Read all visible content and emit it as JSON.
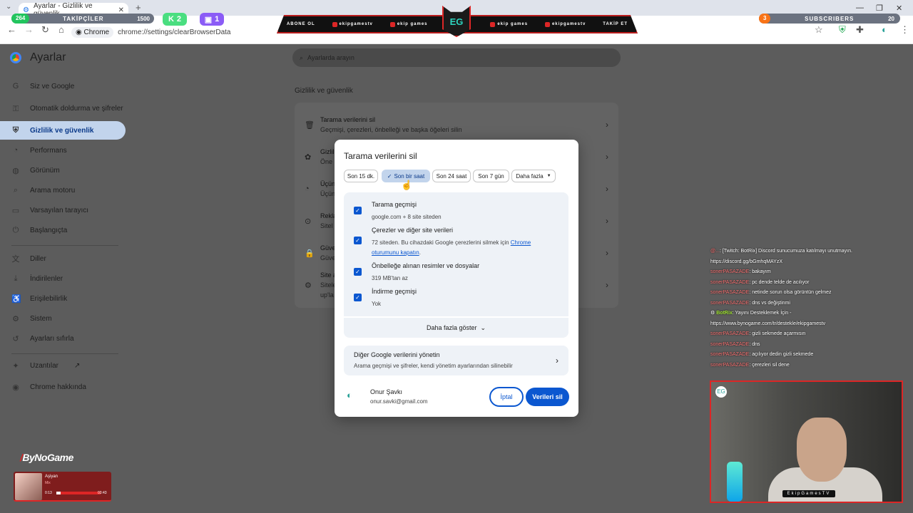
{
  "browser": {
    "tab_title": "Ayarlar - Gizlilik ve güvenlik",
    "tab_close": "✕",
    "new_tab": "+",
    "url_chip": "Chrome",
    "url": "chrome://settings/clearBrowserData"
  },
  "overlay": {
    "followers_count": "264",
    "followers_label": "TAKİPÇİLER",
    "followers_goal": "1500",
    "kick_count": "2",
    "twitch_count": "1",
    "banner_items": [
      "ABONE OL",
      "ekipgamestv",
      "ekip games",
      "ekip games",
      "ekipgamestv",
      "TAKİP ET"
    ],
    "logo_text": "EG",
    "subs_count": "3",
    "subs_label": "SUBSCRIBERS",
    "subs_goal": "20"
  },
  "settings": {
    "brand": "Ayarlar",
    "search_placeholder": "Ayarlarda arayın",
    "section_title": "Gizlilik ve güvenlik",
    "sidebar": [
      {
        "icon": "G",
        "label": "Siz ve Google"
      },
      {
        "icon": "⚿",
        "label": "Otomatik doldurma ve şifreler"
      },
      {
        "icon": "⛨",
        "label": "Gizlilik ve güvenlik"
      },
      {
        "icon": "◔",
        "label": "Performans"
      },
      {
        "icon": "◍",
        "label": "Görünüm"
      },
      {
        "icon": "⌕",
        "label": "Arama motoru"
      },
      {
        "icon": "▭",
        "label": "Varsayılan tarayıcı"
      },
      {
        "icon": "⏻",
        "label": "Başlangıçta"
      },
      {
        "icon": "文",
        "label": "Diller"
      },
      {
        "icon": "⤓",
        "label": "İndirilenler"
      },
      {
        "icon": "♿",
        "label": "Erişilebilirlik"
      },
      {
        "icon": "⚙",
        "label": "Sistem"
      },
      {
        "icon": "↺",
        "label": "Ayarları sıfırla"
      },
      {
        "icon": "✦",
        "label": "Uzantılar"
      },
      {
        "icon": "◉",
        "label": "Chrome hakkında"
      }
    ],
    "card_rows": [
      {
        "title": "Tarama verilerini sil",
        "desc": "Geçmişi, çerezleri, önbelleği ve başka öğeleri silin"
      },
      {
        "title": "Gizlil",
        "desc": "Öne"
      },
      {
        "title": "Üçün",
        "desc": "Üçün"
      },
      {
        "title": "Rekla",
        "desc": "Sitel"
      },
      {
        "title": "Güve",
        "desc": "Güve"
      },
      {
        "title": "Site a",
        "desc": "Sitele",
        "desc2": "up'la"
      }
    ]
  },
  "dialog": {
    "title": "Tarama verilerini sil",
    "time_ranges": [
      "Son 15 dk.",
      "Son bir saat",
      "Son 24 saat",
      "Son 7 gün",
      "Daha fazla"
    ],
    "selected_range": "Son bir saat",
    "options": [
      {
        "title": "Tarama geçmişi",
        "desc": "google.com + 8 site siteden",
        "checked": true
      },
      {
        "title": "Çerezler ve diğer site verileri",
        "desc": "72 siteden. Bu cihazdaki Google çerezlerini silmek için ",
        "link": "Chrome oturumunu kapatın",
        "desc_end": ".",
        "checked": true
      },
      {
        "title": "Önbelleğe alınan resimler ve dosyalar",
        "desc": "319 MB'tan az",
        "checked": true
      },
      {
        "title": "İndirme geçmişi",
        "desc": "Yok",
        "checked": true
      }
    ],
    "more_label": "Daha fazla göster",
    "google_title": "Diğer Google verilerini yönetin",
    "google_desc": "Arama geçmişi ve şifreler, kendi yönetim ayarlarından silinebilir",
    "account_name": "Onur Şavkı",
    "account_email": "onur.savki@gmail.com",
    "cancel_label": "İptal",
    "delete_label": "Verileri sil"
  },
  "chat": [
    {
      "user": "@...",
      "text": ": [Twitch: BotRix] Discord sunucumuza katılmayı unutmayın. https://discord.gg/bGmhqMAYzX"
    },
    {
      "user": "sonerPASAZADE",
      "text": ": bakayım"
    },
    {
      "user": "sonerPASAZADE",
      "text": ": pc dende telde de acılıyor"
    },
    {
      "user": "sonerPASAZADE",
      "text": ": netinde sorun olsa görüntün gelmez"
    },
    {
      "user": "sonerPASAZADE",
      "text": ": dns vs değiştinmi"
    },
    {
      "user": "BotRix",
      "text": ": Yayını Desteklemek İçin - https://www.bynogame.com/tr/destekle/ekipgamestv",
      "bot": true
    },
    {
      "user": "sonerPASAZADE",
      "text": ": gizli sekmede açarmısın"
    },
    {
      "user": "sonerPASAZADE",
      "text": ": dns"
    },
    {
      "user": "sonerPASAZADE",
      "text": ": açılıyor dedin gizli sekmede"
    },
    {
      "user": "sonerPASAZADE",
      "text": ": çerezleri sil dene"
    }
  ],
  "cam_tag": "EkipGamesTV",
  "bynogame": {
    "prefix": "/",
    "name": "ByNoGame"
  },
  "music": {
    "song": "Aşiyan",
    "artist": "Mix",
    "elapsed": "0:13",
    "total": "03:43",
    "progress": 0.1
  }
}
